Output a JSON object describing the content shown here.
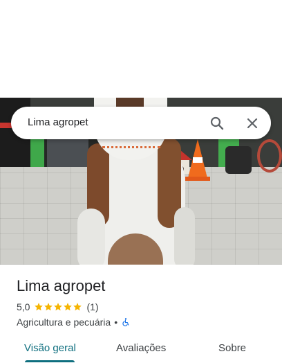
{
  "search": {
    "query": "Lima agropet"
  },
  "place": {
    "name": "Lima agropet",
    "rating": "5,0",
    "stars": 5,
    "review_count": "(1)",
    "category": "Agricultura e pecuária",
    "separator": "•"
  },
  "tabs": [
    {
      "label": "Visão geral",
      "active": true
    },
    {
      "label": "Avaliações",
      "active": false
    },
    {
      "label": "Sobre",
      "active": false
    }
  ],
  "colors": {
    "accent": "#0f6f7f",
    "star": "#f5b400",
    "accessibility": "#1a73e8"
  }
}
